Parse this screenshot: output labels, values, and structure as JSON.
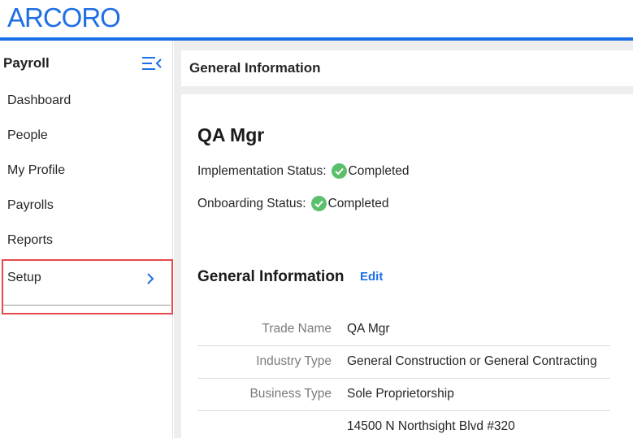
{
  "brand": {
    "logo_text": "ARCORO",
    "color": "#1a6fe6"
  },
  "sidebar": {
    "title": "Payroll",
    "collapse_icon": "menu-collapse-icon",
    "items": [
      {
        "label": "Dashboard"
      },
      {
        "label": "People"
      },
      {
        "label": "My Profile"
      },
      {
        "label": "Payrolls"
      },
      {
        "label": "Reports"
      },
      {
        "label": "Setup",
        "icon": "chevron-right-icon",
        "highlighted": true
      }
    ]
  },
  "header": {
    "title": "General Information"
  },
  "company": {
    "name": "QA Mgr",
    "implementation_status_label": "Implementation Status:",
    "implementation_status_value": "Completed",
    "onboarding_status_label": "Onboarding Status:",
    "onboarding_status_value": "Completed",
    "status_icon": "check-circle-icon",
    "status_color": "#5cbf6c"
  },
  "general_info": {
    "title": "General Information",
    "edit_label": "Edit",
    "rows": [
      {
        "label": "Trade Name",
        "value": "QA Mgr"
      },
      {
        "label": "Industry Type",
        "value": "General Construction or General Contracting"
      },
      {
        "label": "Business Type",
        "value": "Sole Proprietorship"
      },
      {
        "label": "",
        "value": "14500 N Northsight Blvd #320"
      }
    ]
  }
}
